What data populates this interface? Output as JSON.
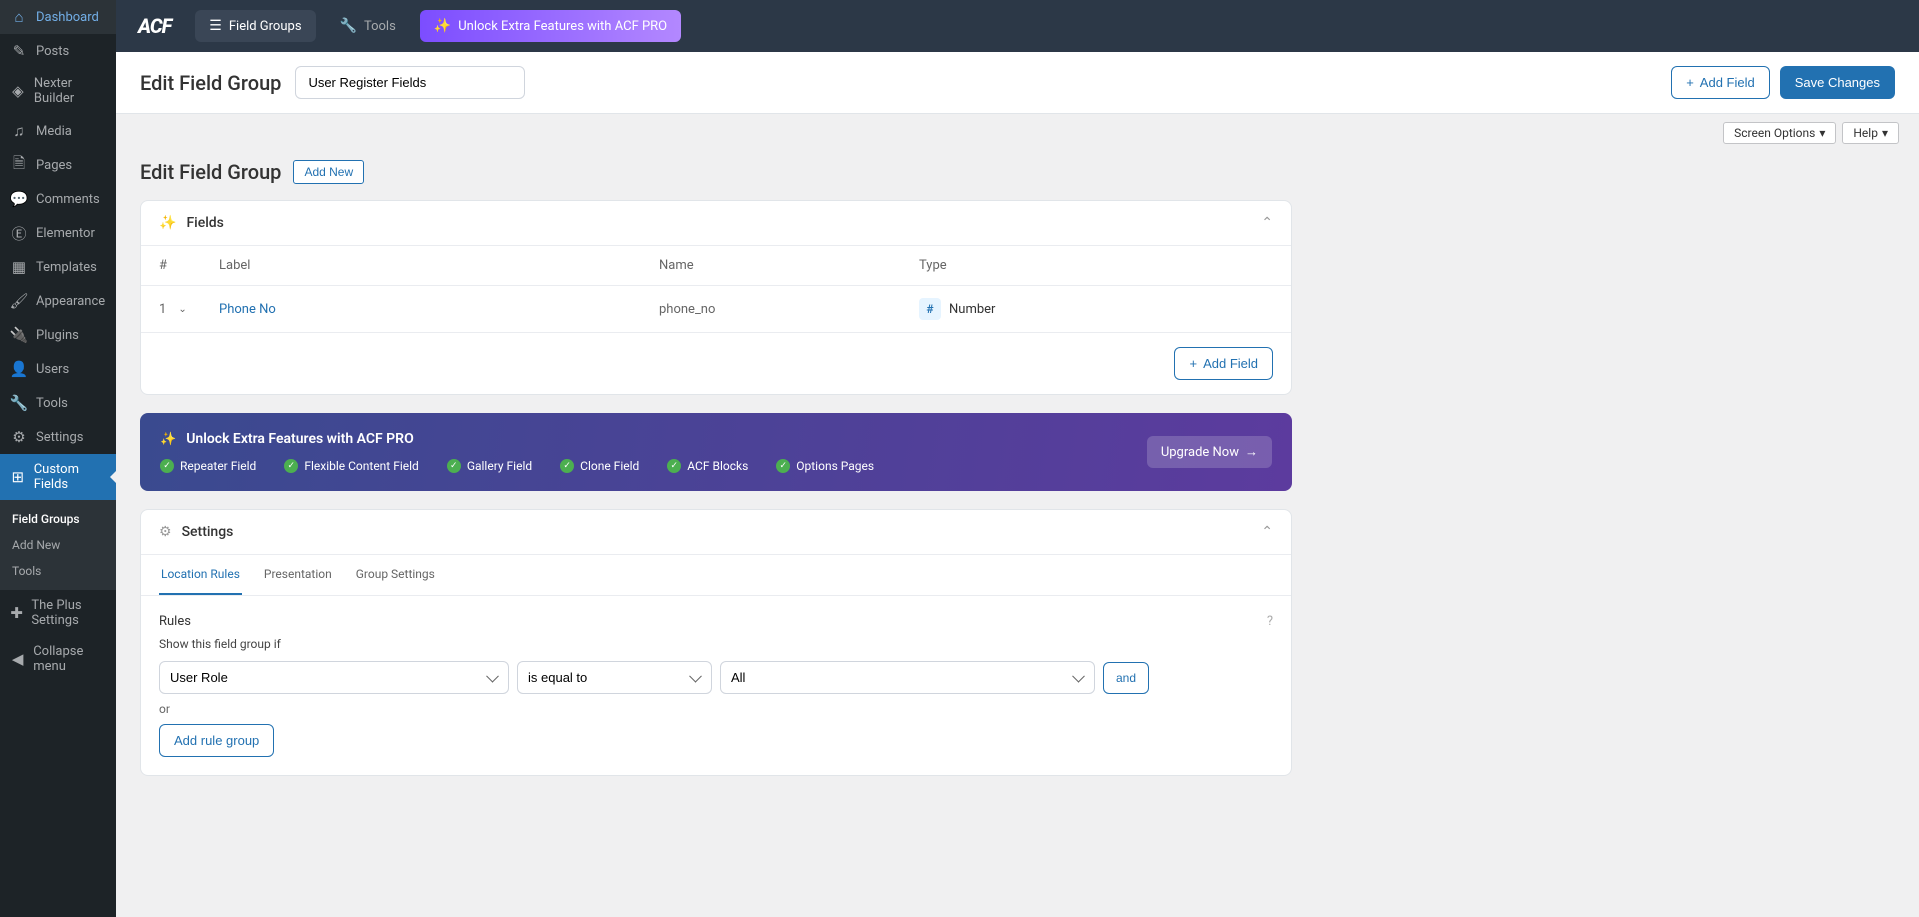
{
  "sidebar": {
    "items": [
      {
        "label": "Dashboard",
        "icon": "dashboard"
      },
      {
        "label": "Posts",
        "icon": "pin"
      },
      {
        "label": "Nexter Builder",
        "icon": "layers"
      },
      {
        "label": "Media",
        "icon": "media"
      },
      {
        "label": "Pages",
        "icon": "page"
      },
      {
        "label": "Comments",
        "icon": "comment"
      },
      {
        "label": "Elementor",
        "icon": "elementor"
      },
      {
        "label": "Templates",
        "icon": "template"
      },
      {
        "label": "Appearance",
        "icon": "brush"
      },
      {
        "label": "Plugins",
        "icon": "plug"
      },
      {
        "label": "Users",
        "icon": "user"
      },
      {
        "label": "Tools",
        "icon": "wrench"
      },
      {
        "label": "Settings",
        "icon": "sliders"
      },
      {
        "label": "Custom Fields",
        "icon": "grid",
        "current": true
      },
      {
        "label": "The Plus Settings",
        "icon": "plus"
      },
      {
        "label": "Collapse menu",
        "icon": "collapse"
      }
    ],
    "submenu": [
      {
        "label": "Field Groups",
        "current": true
      },
      {
        "label": "Add New"
      },
      {
        "label": "Tools"
      }
    ]
  },
  "topbar": {
    "logo": "ACF",
    "field_groups": "Field Groups",
    "tools": "Tools",
    "unlock": "Unlock Extra Features with ACF PRO"
  },
  "header": {
    "title": "Edit Field Group",
    "input_value": "User Register Fields",
    "add_field": "Add Field",
    "save": "Save Changes"
  },
  "meta": {
    "screen_options": "Screen Options",
    "help": "Help"
  },
  "page": {
    "heading": "Edit Field Group",
    "add_new": "Add New"
  },
  "fields_panel": {
    "title": "Fields",
    "cols": {
      "num": "#",
      "label": "Label",
      "name": "Name",
      "type": "Type"
    },
    "rows": [
      {
        "num": "1",
        "label": "Phone No",
        "name": "phone_no",
        "type": "Number",
        "type_icon": "#"
      }
    ],
    "add_field": "Add Field"
  },
  "promo": {
    "title": "Unlock Extra Features with ACF PRO",
    "features": [
      "Repeater Field",
      "Flexible Content Field",
      "Gallery Field",
      "Clone Field",
      "ACF Blocks",
      "Options Pages"
    ],
    "cta": "Upgrade Now"
  },
  "settings_panel": {
    "title": "Settings",
    "tabs": [
      "Location Rules",
      "Presentation",
      "Group Settings"
    ],
    "rules_label": "Rules",
    "show_if": "Show this field group if",
    "rule": {
      "param": "User Role",
      "operator": "is equal to",
      "value": "All"
    },
    "and": "and",
    "or": "or",
    "add_group": "Add rule group"
  }
}
